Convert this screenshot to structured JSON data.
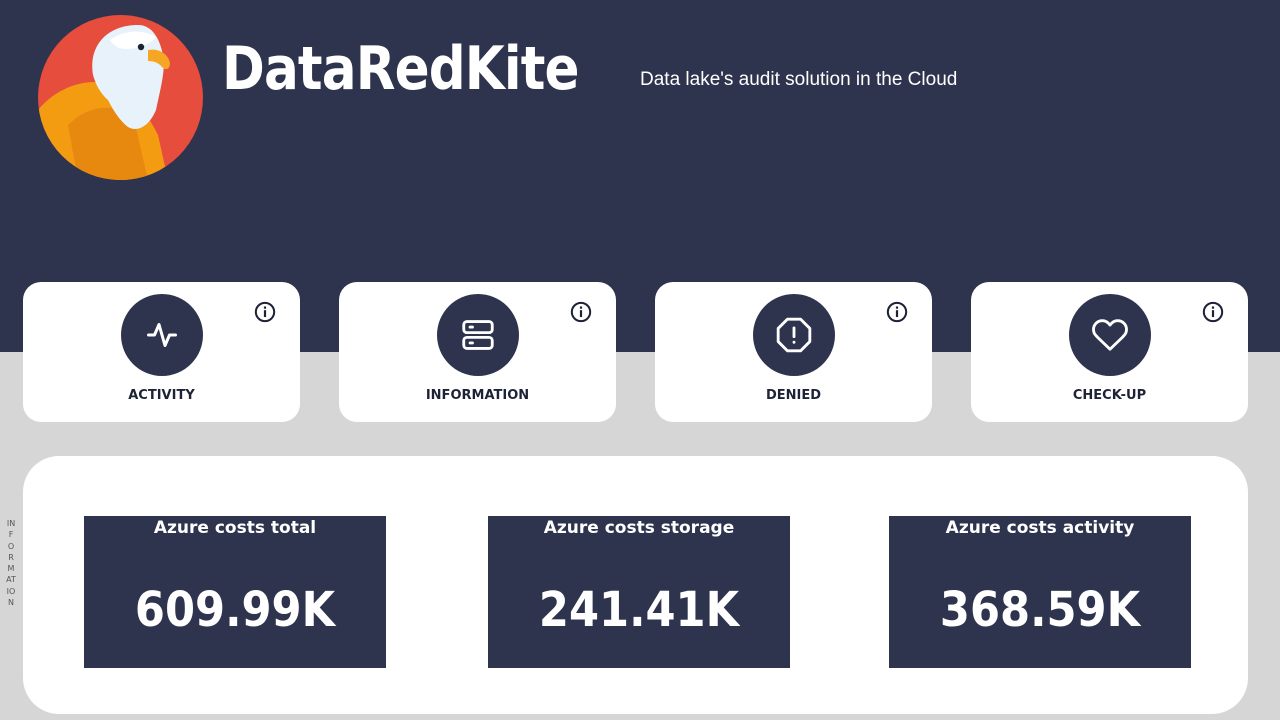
{
  "app": {
    "brand": "DataRedKite",
    "tagline": "Data lake's audit solution in the Cloud"
  },
  "nav": [
    {
      "label": "ACTIVITY",
      "icon": "activity-pulse-icon"
    },
    {
      "label": "INFORMATION",
      "icon": "server-icon"
    },
    {
      "label": "DENIED",
      "icon": "alert-octagon-icon"
    },
    {
      "label": "CHECK-UP",
      "icon": "heart-icon"
    }
  ],
  "side_label": "INFORMATION",
  "kpis": [
    {
      "title": "Azure costs total",
      "value": "609.99K"
    },
    {
      "title": "Azure costs storage",
      "value": "241.41K"
    },
    {
      "title": "Azure costs activity",
      "value": "368.59K"
    }
  ],
  "colors": {
    "header": "#2e344e",
    "background": "#d6d6d6",
    "card": "#ffffff",
    "logo_red": "#e64d3d",
    "logo_orange": "#f39c12"
  }
}
